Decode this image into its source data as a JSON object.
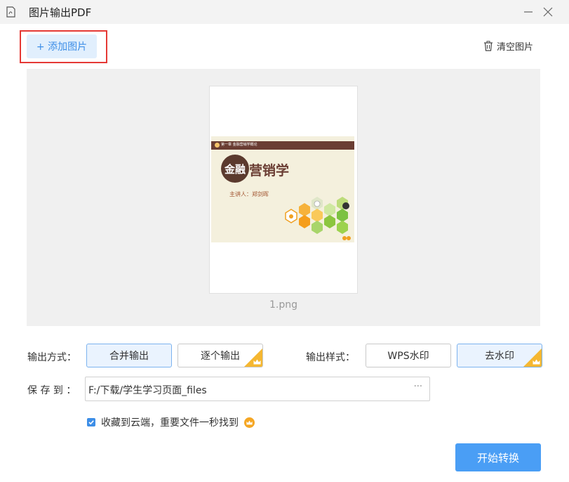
{
  "window": {
    "title": "图片输出PDF"
  },
  "toolbar": {
    "add_label": "+ 添加图片",
    "clear_label": "清空图片"
  },
  "preview": {
    "items": [
      {
        "file_name": "1.png",
        "slide": {
          "band_text": "第一章 金融营销学概论",
          "title_circle": "金融",
          "title_rest": "营销学",
          "speaker": "主讲人：郑剑晖"
        }
      }
    ]
  },
  "output_mode": {
    "label": "输出方式：",
    "options": [
      "合并输出",
      "逐个输出"
    ],
    "selected": "合并输出"
  },
  "output_style": {
    "label": "输出样式：",
    "options": [
      "WPS水印",
      "去水印"
    ],
    "selected": "去水印"
  },
  "save": {
    "label": "保 存 到 ：",
    "path": "F:/下载/学生学习页面_files",
    "more": "···"
  },
  "cloud": {
    "checked": true,
    "label": "收藏到云端，重要文件一秒找到"
  },
  "start_button": "开始转换",
  "colors": {
    "accent": "#4a9ef5",
    "vip": "#f5b731",
    "highlight": "#e53935"
  }
}
